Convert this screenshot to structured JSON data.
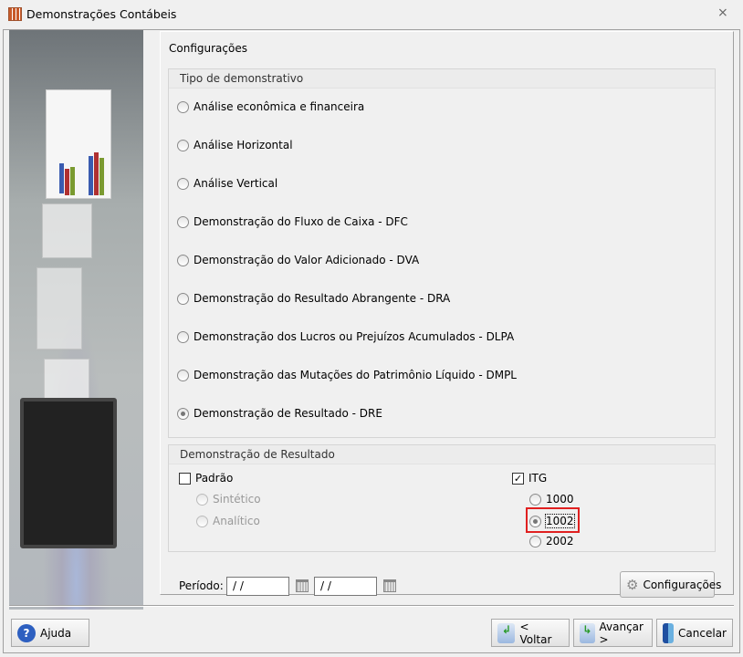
{
  "window": {
    "title": "Demonstrações Contábeis",
    "close": "⨯"
  },
  "main": {
    "title": "Configurações"
  },
  "tipo": {
    "header": "Tipo de demonstrativo",
    "options": [
      {
        "label": "Análise econômica e financeira",
        "selected": false
      },
      {
        "label": "Análise Horizontal",
        "selected": false
      },
      {
        "label": "Análise Vertical",
        "selected": false
      },
      {
        "label": "Demonstração do Fluxo de Caixa - DFC",
        "selected": false
      },
      {
        "label": "Demonstração do Valor Adicionado - DVA",
        "selected": false
      },
      {
        "label": "Demonstração do Resultado Abrangente - DRA",
        "selected": false
      },
      {
        "label": "Demonstração dos Lucros ou Prejuízos Acumulados - DLPA",
        "selected": false
      },
      {
        "label": "Demonstração das Mutações do Patrimônio Líquido - DMPL",
        "selected": false
      },
      {
        "label": "Demonstração de Resultado - DRE",
        "selected": true
      }
    ]
  },
  "dre": {
    "header": "Demonstração de Resultado",
    "padrao": {
      "label": "Padrão",
      "checked": false
    },
    "sintetico": "Sintético",
    "analitico": "Analítico",
    "itg": {
      "label": "ITG",
      "checked": true,
      "check": "✓"
    },
    "itg_options": [
      {
        "label": "1000"
      },
      {
        "label": "1002",
        "selected": true
      },
      {
        "label": "2002"
      }
    ]
  },
  "periodo": {
    "label": "Período:",
    "start": "/ /",
    "end": "/ /"
  },
  "buttons": {
    "config": "Configurações",
    "ajuda": "Ajuda",
    "voltar": "< Voltar",
    "avancar": "Avançar >",
    "cancelar": "Cancelar"
  }
}
